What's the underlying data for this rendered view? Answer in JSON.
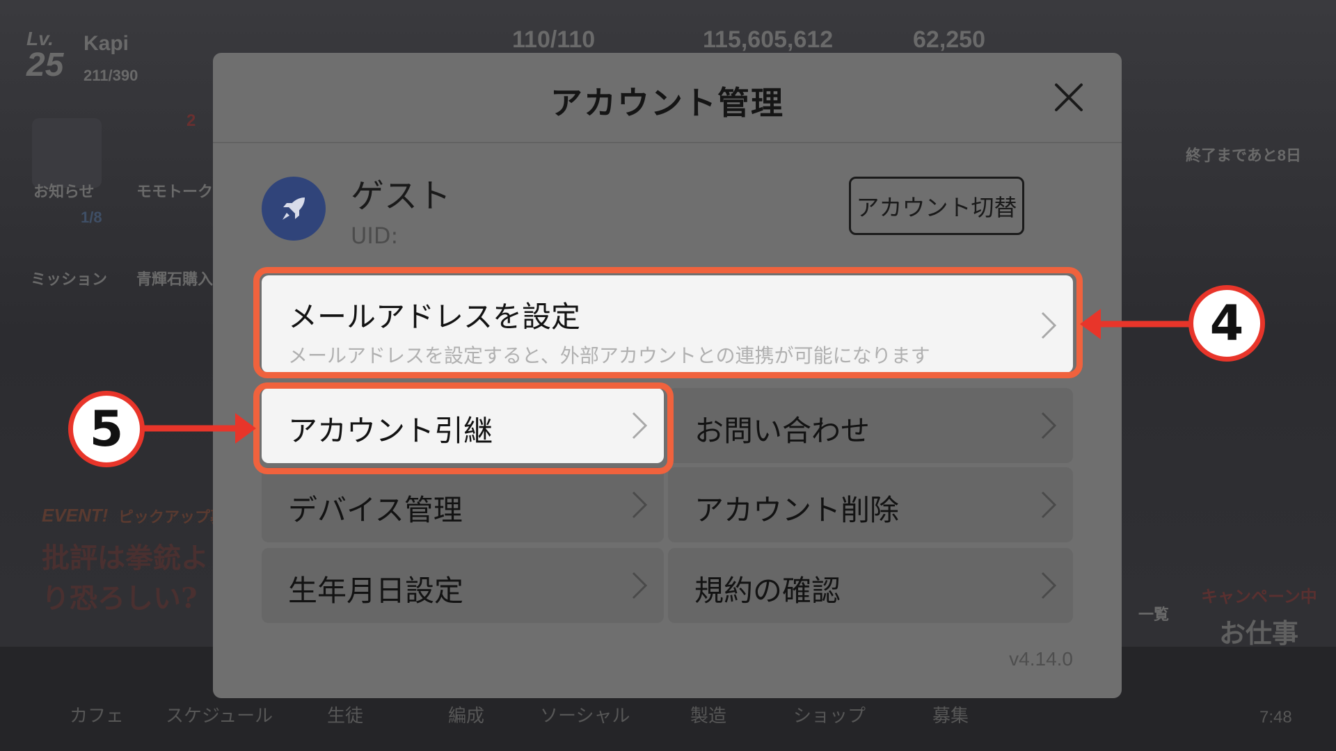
{
  "background": {
    "level_prefix": "Lv.",
    "level": "25",
    "player_name": "Kapi",
    "player_xp": "211/390",
    "stamina": "110/110",
    "credits": "115,605,612",
    "gems": "62,250",
    "left_menu": [
      "お知らせ",
      "モモトーク",
      "ミッション",
      "青輝石購入"
    ],
    "left_badge": "1/8",
    "notice_count": "2",
    "event_tag": "EVENT!",
    "pickup_tag": "ピックアップ募集",
    "event_banner": "批評は拳銃より恐ろしい?",
    "right_timer": "終了まであと8日",
    "campaign_tag": "キャンペーン中",
    "work_label": "お仕事",
    "list_label": "一覧",
    "clock": "7:48",
    "bottom_nav": [
      "カフェ",
      "スケジュール",
      "生徒",
      "編成",
      "ソーシャル",
      "製造",
      "ショップ",
      "募集"
    ]
  },
  "dialog": {
    "title": "アカウント管理",
    "user": {
      "name": "ゲスト",
      "uid_label": "UID:",
      "switch_label": "アカウント切替"
    },
    "email": {
      "label": "メールアドレスを設定",
      "description": "メールアドレスを設定すると、外部アカウントとの連携が可能になります"
    },
    "items_left": [
      "アカウント引継",
      "デバイス管理",
      "生年月日設定"
    ],
    "items_right": [
      "お問い合わせ",
      "アカウント削除",
      "規約の確認"
    ],
    "version": "v4.14.0"
  },
  "callouts": {
    "step_email": "4",
    "step_transfer": "5"
  },
  "colors": {
    "highlight_border": "#f0623d",
    "callout_ring": "#e8352a",
    "avatar_bg": "#30447a"
  }
}
